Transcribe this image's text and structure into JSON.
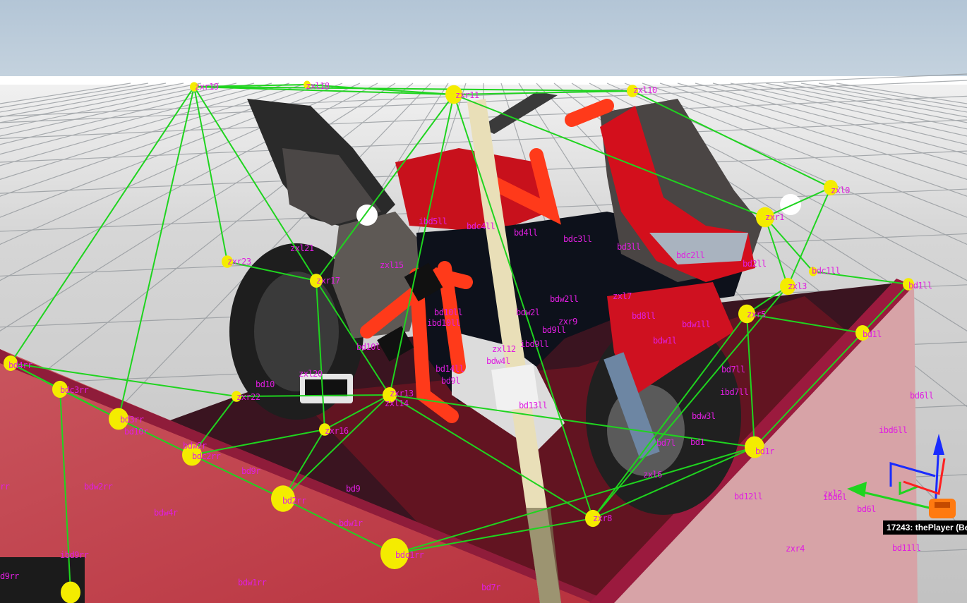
{
  "scene": {
    "vehicle_tooltip": "17243: thePlayer (Be",
    "colors": {
      "sky": "#b7c8d8",
      "floor": "#cbcbcb",
      "beam": "#1fd41f",
      "node": "#f4ec00",
      "label": "#e01ee0",
      "truck": "#b9303f",
      "fairing": "#d4101e",
      "frame": "#ff3a1a"
    },
    "icons": [
      "player-car-icon",
      "axis-gizmo-icon"
    ],
    "node_labels": [
      "zxr19",
      "zxl18",
      "zxr11",
      "zxl10",
      "zxl0",
      "zxr1",
      "ibd5ll",
      "bdc4ll",
      "bd4ll",
      "bdc3ll",
      "bd3ll",
      "bdc2ll",
      "zxl21",
      "zxr23",
      "zxl15",
      "zxr17",
      "bd2ll",
      "bdc1ll",
      "bd1ll",
      "zxl3",
      "zxl7",
      "bdw2ll",
      "bdw2l",
      "bd10ll",
      "ibd10ll",
      "zxr5",
      "bd8ll",
      "bdw1ll",
      "zxr9",
      "bd9ll",
      "ibd9ll",
      "bdw1l",
      "bd1l",
      "bd10l",
      "zxl12",
      "bdw4l",
      "bd14ll",
      "bd7ll",
      "zxl20",
      "bd9l",
      "bd4rr",
      "bdc3rr",
      "bd10",
      "ibd7ll",
      "zxr22",
      "zxr13",
      "zxl14",
      "bd13ll",
      "bd6ll",
      "bd3rr",
      "bd10r",
      "bdw3l",
      "zxr16",
      "ibd6ll",
      "bdw2r",
      "bdc2rr",
      "bd7l",
      "bd1",
      "bd1r",
      "bd9r",
      "bdw2rr",
      "rr",
      "zxl6",
      "bd9",
      "bd2rr",
      "bd12ll",
      "zxl2",
      "ibd6l",
      "bd6l",
      "bdw4r",
      "bdw1r",
      "zxr8",
      "zxr4",
      "bd11ll",
      "ibd9rr",
      "bdc1rr",
      "bdw1rr",
      "d9rr",
      "bd7r"
    ]
  }
}
